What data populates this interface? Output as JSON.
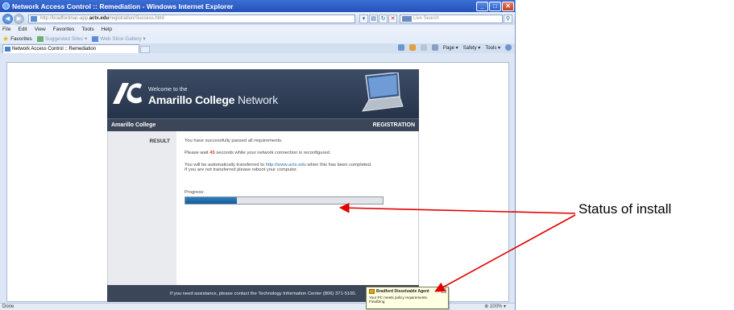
{
  "browser": {
    "window_title": "Network Access Control :: Remediation - Windows Internet Explorer",
    "address_prefix": "http://bradfordnac-app.",
    "address_domain": "actx.edu",
    "address_suffix": "/registration/Success.html",
    "search_placeholder": "Live Search",
    "menu": [
      "File",
      "Edit",
      "View",
      "Favorites",
      "Tools",
      "Help"
    ],
    "favorites_label": "Favorites",
    "fav_links": [
      "Suggested Sites ▾",
      "Web Slice Gallery ▾"
    ],
    "tab_title": "Network Access Control :: Remediation",
    "commands": [
      "Page ▾",
      "Safety ▾",
      "Tools ▾"
    ],
    "status_text": "Done",
    "zoom_text": "100%"
  },
  "page": {
    "welcome": "Welcome to the",
    "brand_name": "Amarillo College",
    "brand_suffix": "Network",
    "org_name": "Amarillo College",
    "section_label": "REGISTRATION",
    "result_label": "RESULT",
    "line1": "You have successfully passed all requirements.",
    "wait_prefix": "Please wait",
    "wait_seconds": "45",
    "wait_suffix": "seconds while your network connection is reconfigured.",
    "transfer_prefix": "You will be automatically transferred to",
    "transfer_link": "http://www.actx.edu",
    "transfer_suffix": "when this has been completed.",
    "reboot_text": "If you are not transferred please reboot your computer.",
    "progress_label": "Progress:",
    "progress_fraction": 0.26,
    "footer_text": "If you need assistance, please contact the Technology Information Center (806) 371-5100."
  },
  "notification": {
    "title": "Bradford Dissolvable Agent",
    "line1": "Your PC meets policy requirements.",
    "line2": "Finalizing"
  },
  "annotation": {
    "text": "Status of install"
  },
  "colors": {
    "banner": "#2d3b52",
    "progress": "#1f6aa8",
    "arrow": "#e00000",
    "balloon": "#ffffe1"
  }
}
